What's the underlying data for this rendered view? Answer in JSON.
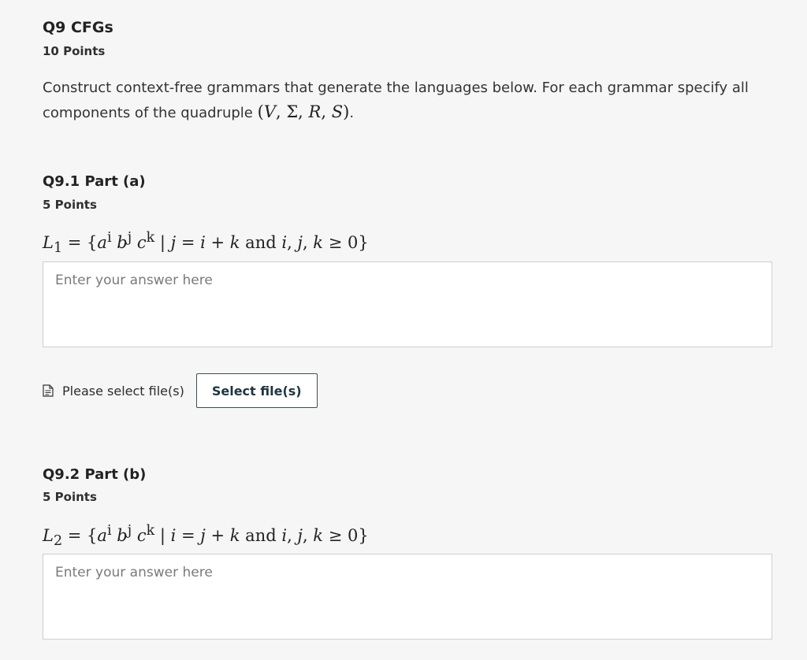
{
  "question": {
    "title": "Q9 CFGs",
    "points": "10 Points",
    "prompt_text": "Construct context-free grammars that generate the languages below. For each grammar specify all components of the quadruple",
    "prompt_math": "(V, Σ, R, S)",
    "prompt_end": "."
  },
  "parts": [
    {
      "title": "Q9.1 Part (a)",
      "points": "5 Points",
      "language": "L1 = {a^i b^j c^k | j = i + k and i, j, k ≥ 0}",
      "answer_placeholder": "Enter your answer here",
      "answer_value": ""
    },
    {
      "title": "Q9.2 Part (b)",
      "points": "5 Points",
      "language": "L2 = {a^i b^j c^k | i = j + k and i, j, k ≥ 0}",
      "answer_placeholder": "Enter your answer here",
      "answer_value": ""
    }
  ],
  "file_upload": {
    "status_label": "Please select file(s)",
    "button_label": "Select file(s)",
    "icon": "document-icon"
  }
}
